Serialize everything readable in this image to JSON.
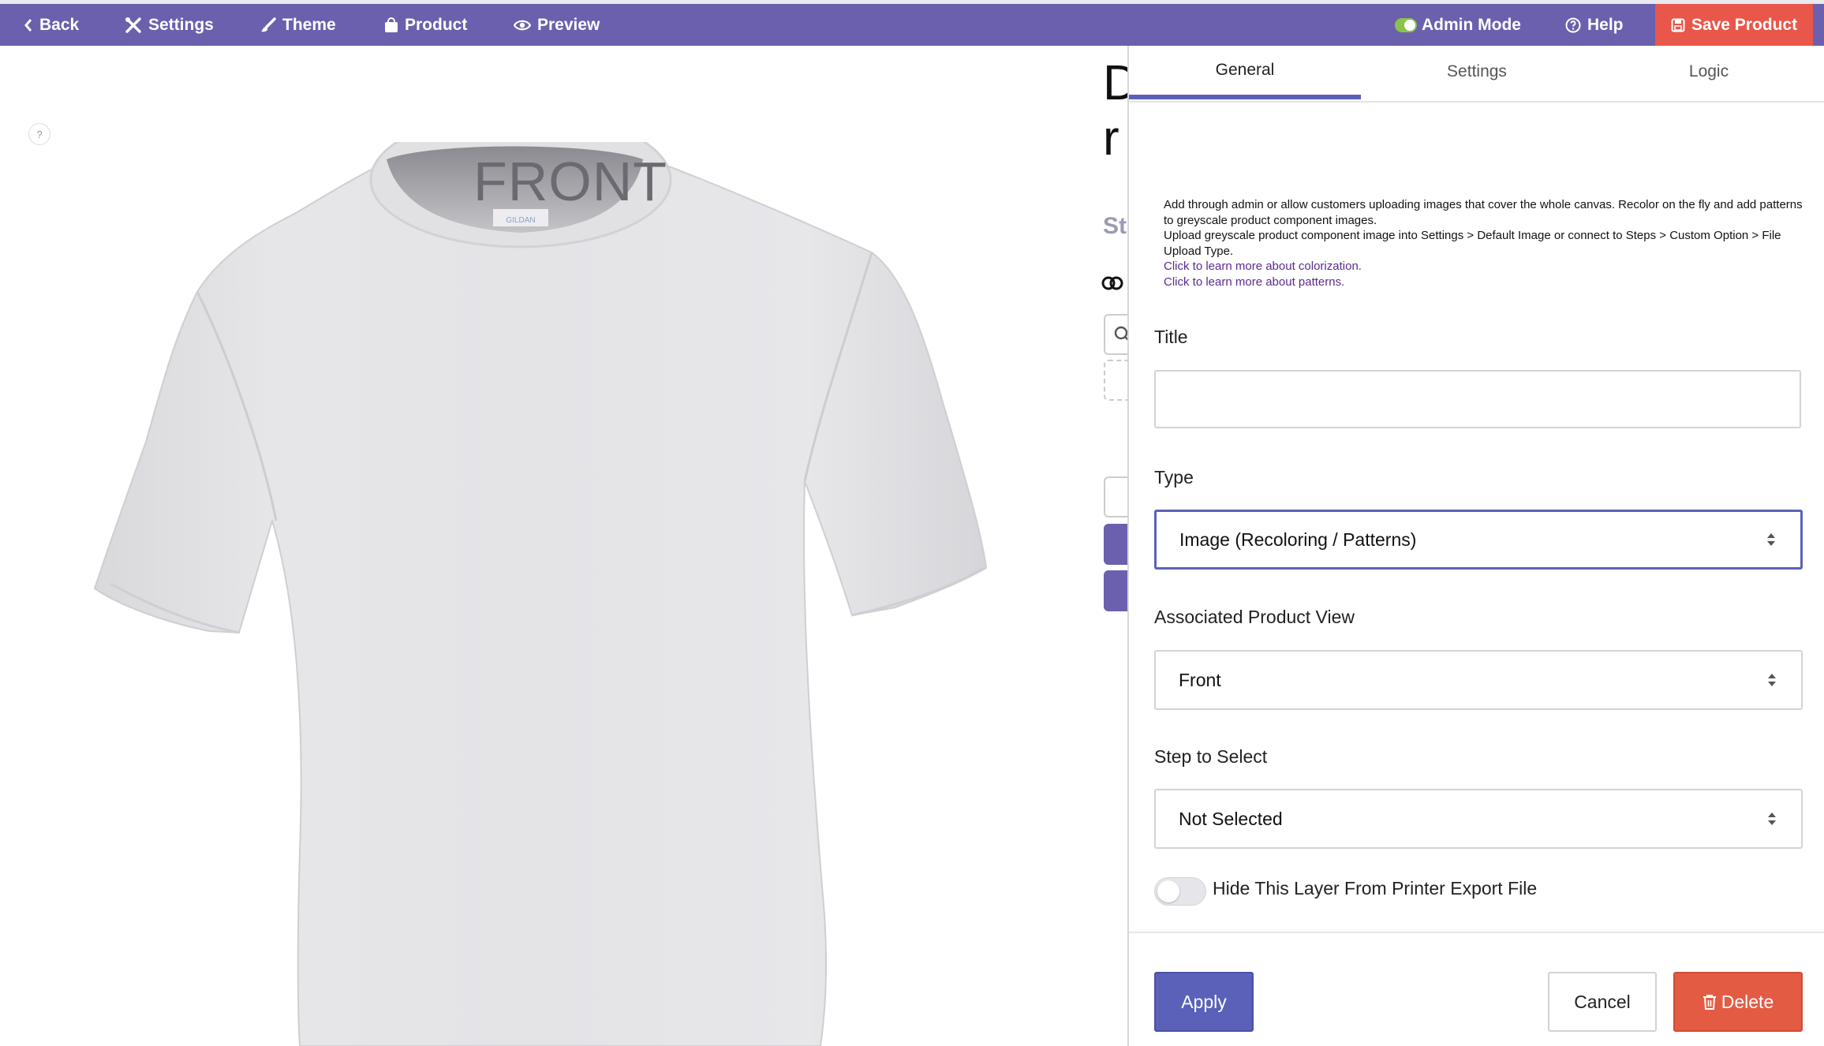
{
  "topbar": {
    "back_label": "Back",
    "settings_label": "Settings",
    "theme_label": "Theme",
    "product_label": "Product",
    "preview_label": "Preview",
    "admin_mode_label": "Admin Mode",
    "help_label": "Help",
    "save_label": "Save Product",
    "accent_color": "#6b60ad",
    "save_color": "#e8574a"
  },
  "canvas": {
    "help_badge": "?",
    "view_label": "FRONT",
    "collar_tag": "GILDAN"
  },
  "middle": {
    "heading_line1_fragment": "D",
    "heading_line2_fragment": "r",
    "steps_fragment": "St"
  },
  "panel": {
    "tabs": [
      {
        "label": "General",
        "active": true
      },
      {
        "label": "Settings",
        "active": false
      },
      {
        "label": "Logic",
        "active": false
      }
    ],
    "intro_lines": [
      "Add through admin or allow customers uploading images that cover the whole canvas. Recolor on the fly and add patterns to greyscale product component images.",
      "Upload greyscale product component image into Settings > Default Image or connect to Steps > Custom Option > File Upload Type."
    ],
    "links": [
      "Click to learn more about colorization.",
      "Click to learn more about patterns."
    ],
    "title_label": "Title",
    "title_value": "",
    "type_label": "Type",
    "type_value": "Image (Recoloring / Patterns)",
    "view_label": "Associated Product View",
    "view_value": "Front",
    "step_label": "Step to Select",
    "step_value": "Not Selected",
    "hide_layer_label": "Hide This Layer From Printer Export File",
    "hide_layer_enabled": false,
    "apply_label": "Apply",
    "cancel_label": "Cancel",
    "delete_label": "Delete",
    "primary_color": "#5b61b8",
    "danger_color": "#e35b43"
  }
}
